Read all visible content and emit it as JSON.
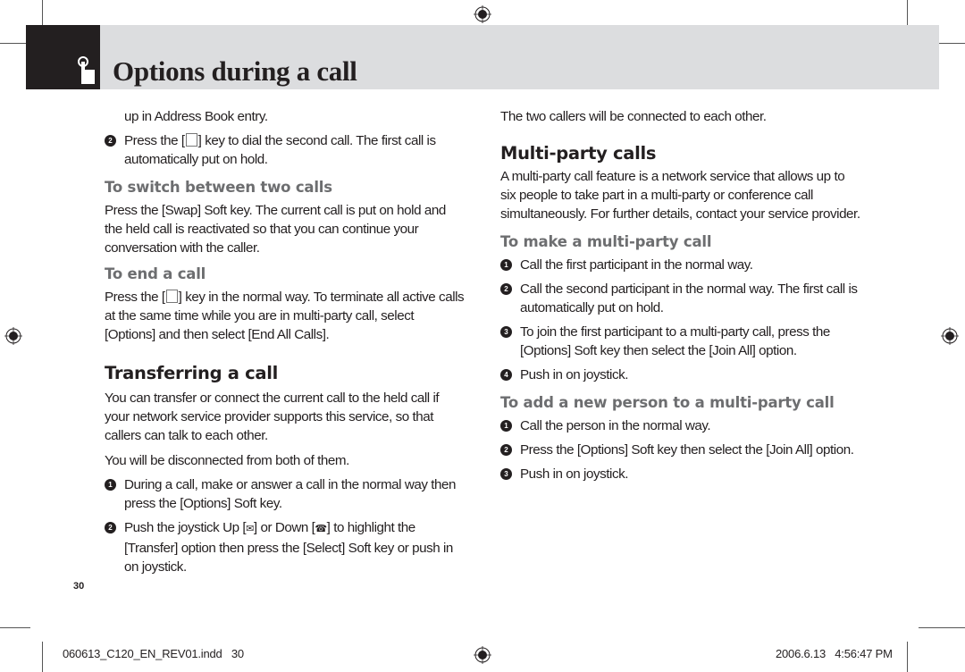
{
  "header": {
    "title": "Options during a call",
    "icon": "hand-pointer-icon"
  },
  "left_column": {
    "intro_continuation": "up in Address Book entry.",
    "intro_step": {
      "number": "2",
      "before_key": "Press the [",
      "key_icon": "send-key-icon",
      "after_key": "] key to dial the second call. The first call is automatically put on hold."
    },
    "switch_section": {
      "heading": "To switch between two calls",
      "body": "Press the [Swap] Soft key. The current call is put on hold and the held call is reactivated so that you can continue your conversation with the caller."
    },
    "end_section": {
      "heading": "To end a call",
      "before_key": "Press the [",
      "key_icon": "send-key-icon",
      "after_key": "] key in the normal way. To terminate all active calls at the same time while you are in multi-party call, select [Options] and then select [End All Calls]."
    },
    "transfer_section": {
      "heading": "Transferring a call",
      "body1": "You can transfer or connect  the current call to the held call if your network service provider supports this service, so that callers can talk to each other.",
      "body2": "You will be disconnected from both of them.",
      "steps": [
        {
          "number": "1",
          "text": "During a call, make or answer a call in the normal way then press the [Options] Soft key."
        },
        {
          "number": "2",
          "before_up": "Push the joystick Up [",
          "up_icon": "envelope-icon",
          "mid": "] or Down [",
          "down_icon": "phone-icon",
          "after": "] to highlight the [Transfer] option then press the [Select] Soft key or push in on joystick."
        }
      ]
    },
    "page_number": "30"
  },
  "right_column": {
    "intro": "The two callers will be connected to each other.",
    "multiparty_section": {
      "heading": "Multi-party calls",
      "body": "A multi-party call feature is a network service that allows up to six people to take part in a multi-party or conference call simultaneously. For further details, contact your service provider."
    },
    "make_section": {
      "heading": "To make a multi-party call",
      "steps": [
        {
          "number": "1",
          "text": "Call the first participant in the normal way."
        },
        {
          "number": "2",
          "text": "Call the second participant in the normal way. The first call is automatically put on hold."
        },
        {
          "number": "3",
          "text": "To join the first participant to a multi-party call, press the [Options] Soft key then select the [Join All] option."
        },
        {
          "number": "4",
          "text": "Push in on joystick."
        }
      ]
    },
    "add_section": {
      "heading": "To add a new person to a multi-party call",
      "steps": [
        {
          "number": "1",
          "text": "Call the person in the normal way."
        },
        {
          "number": "2",
          "text": "Press the [Options] Soft key then select the [Join All] option."
        },
        {
          "number": "3",
          "text": "Push in on joystick."
        }
      ]
    }
  },
  "footer": {
    "filename": "060613_C120_EN_REV01.indd   30",
    "timestamp": "2006.6.13   4:56:47 PM"
  },
  "colors": {
    "header_bar": "#dcdddf",
    "header_block": "#231f20",
    "subheading": "#6d6e70",
    "text": "#231f20"
  }
}
